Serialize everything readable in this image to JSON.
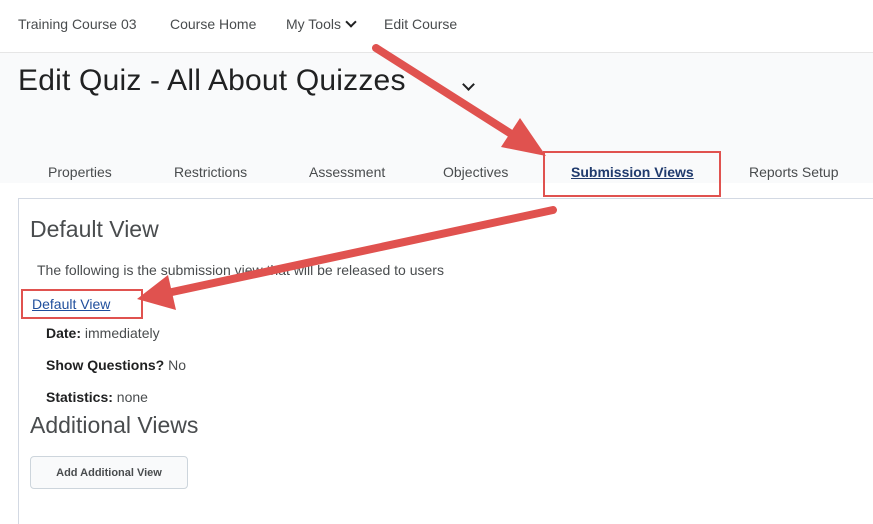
{
  "nav": {
    "course": "Training Course 03",
    "home": "Course Home",
    "tools": "My Tools",
    "edit_course": "Edit Course"
  },
  "page": {
    "title": "Edit Quiz - All About Quizzes"
  },
  "tabs": [
    {
      "label": "Properties"
    },
    {
      "label": "Restrictions"
    },
    {
      "label": "Assessment"
    },
    {
      "label": "Objectives"
    },
    {
      "label": "Submission Views"
    },
    {
      "label": "Reports Setup"
    }
  ],
  "default_view": {
    "heading": "Default View",
    "description": "The following is the submission view that will be released to users",
    "link": "Default View",
    "date_label": "Date:",
    "date_value": " immediately",
    "questions_label": "Show Questions?",
    "questions_value": " No",
    "stats_label": "Statistics:",
    "stats_value": " none"
  },
  "additional_views": {
    "heading": "Additional Views",
    "button": "Add Additional View"
  },
  "colors": {
    "annotation": "#e0524f",
    "link": "#1f4e9c"
  },
  "icons": [
    "chevron-down-icon",
    "annotation-arrow"
  ]
}
